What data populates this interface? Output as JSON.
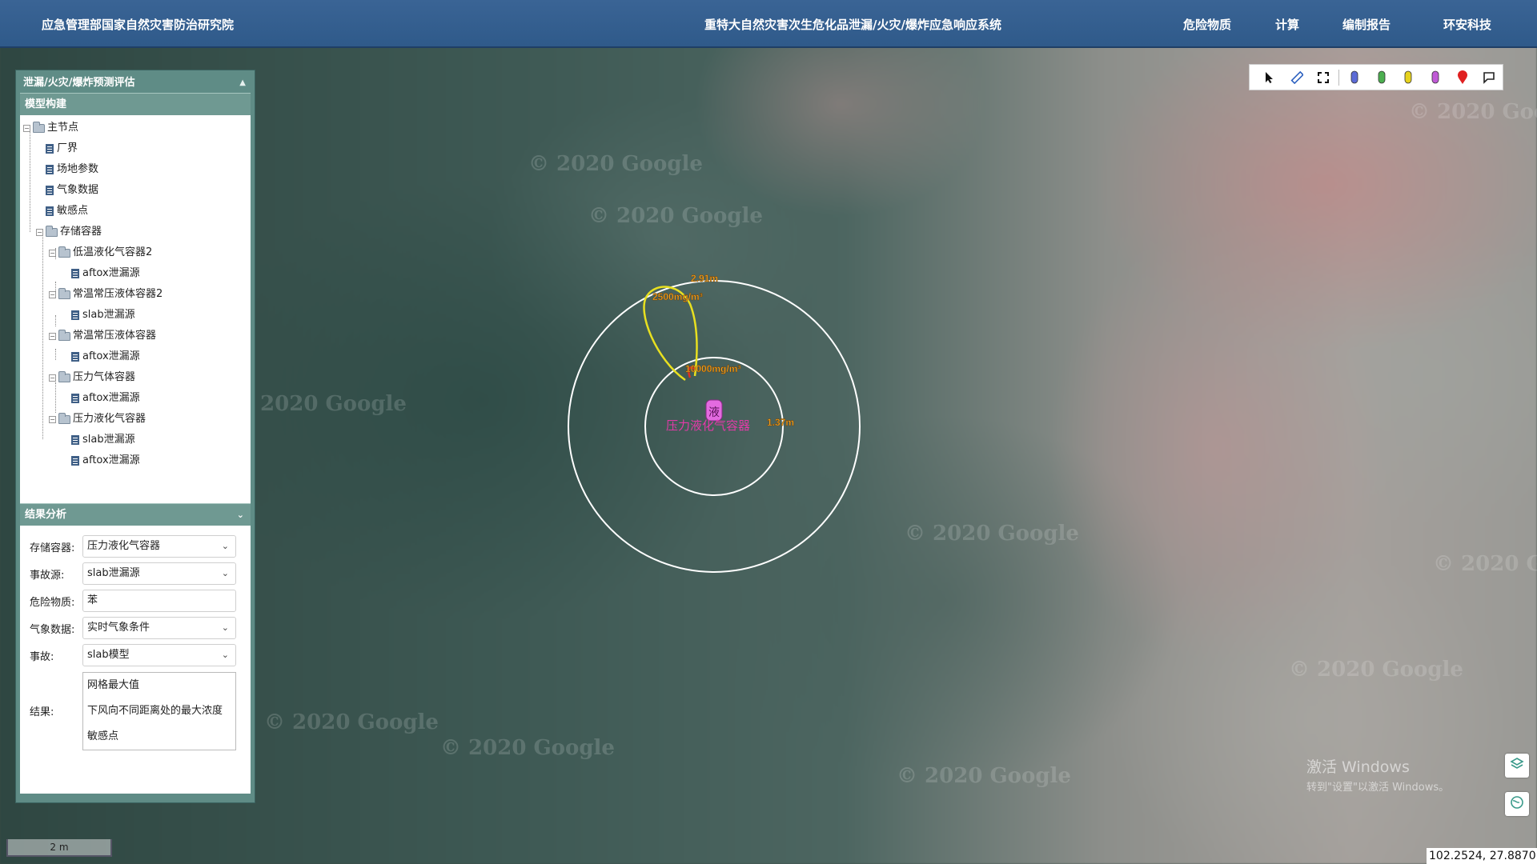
{
  "header": {
    "org_title": "应急管理部国家自然灾害防治研究院",
    "system_title": "重特大自然灾害次生危化品泄漏/火灾/爆炸应急响应系统",
    "nav": [
      "危险物质",
      "计算",
      "编制报告",
      "环安科技"
    ]
  },
  "panel": {
    "title": "泄漏/火灾/爆炸预测评估",
    "model_section": "模型构建",
    "tree": {
      "root": "主节点",
      "plant_boundary": "厂界",
      "site_params": "场地参数",
      "weather_data": "气象数据",
      "sensitive_points": "敏感点",
      "storage": "存储容器",
      "containers": [
        {
          "name": "低温液化气容器2",
          "source": "aftox泄漏源"
        },
        {
          "name": "常温常压液体容器2",
          "source": "slab泄漏源"
        },
        {
          "name": "常温常压液体容器",
          "source": "aftox泄漏源"
        },
        {
          "name": "压力气体容器",
          "source": "aftox泄漏源"
        },
        {
          "name": "压力液化气容器",
          "sources": [
            "slab泄漏源",
            "aftox泄漏源"
          ]
        }
      ]
    },
    "result_section": "结果分析",
    "form": {
      "container_label": "存储容器:",
      "container_value": "压力液化气容器",
      "source_label": "事故源:",
      "source_value": "slab泄漏源",
      "substance_label": "危险物质:",
      "substance_value": "苯",
      "weather_label": "气象数据:",
      "weather_value": "实时气象条件",
      "accident_label": "事故:",
      "accident_value": "slab模型",
      "result_label": "结果:",
      "results": [
        "网格最大值",
        "下风向不同距离处的最大浓度",
        "敏感点"
      ]
    }
  },
  "toolbar": {
    "tools": [
      "pointer-icon",
      "ruler-icon",
      "fullscreen-icon"
    ],
    "markers": [
      {
        "icon": "blue-marker-icon",
        "color": "#5c6bd6"
      },
      {
        "icon": "green-marker-icon",
        "color": "#4caf50"
      },
      {
        "icon": "yellow-marker-icon",
        "color": "#e6d21e"
      },
      {
        "icon": "purple-marker-icon",
        "color": "#c05ad6"
      },
      {
        "icon": "red-pin-icon",
        "color": "#e02020"
      },
      {
        "icon": "flag-icon",
        "color": "#222222"
      }
    ]
  },
  "map": {
    "watermark": "© 2020 Google",
    "vessel_icon_text": "液",
    "vessel_label": "压力液化气容器",
    "outer_radius_label": "2.91m",
    "inner_radius_label": "1.37m",
    "contour_low_label": "2500mg/m³",
    "contour_high_label": "10000mg/m³",
    "colors": {
      "vessel": "#e23aa8",
      "contour_low": "#e8e020",
      "contour_high": "#e03020",
      "label": "#f0a020"
    }
  },
  "footer": {
    "scale": "2 m",
    "coordinates": "102.2524, 27.8870",
    "activate_title": "激活 Windows",
    "activate_sub": "转到\"设置\"以激活 Windows。"
  }
}
